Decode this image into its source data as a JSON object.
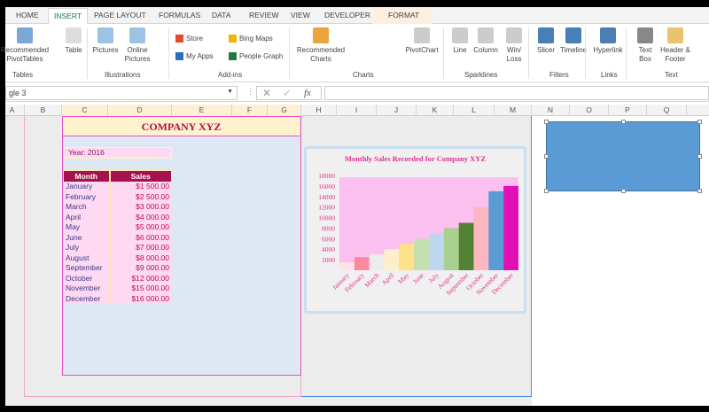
{
  "ribbon": {
    "tabs": [
      "HOME",
      "INSERT",
      "PAGE LAYOUT",
      "FORMULAS",
      "DATA",
      "REVIEW",
      "VIEW",
      "DEVELOPER",
      "FORMAT"
    ],
    "active_tab": "INSERT",
    "buttons": {
      "recommended_pivot": "Recommended PivotTables",
      "table": "Table",
      "pictures": "Pictures",
      "online_pictures": "Online Pictures",
      "store": "Store",
      "my_apps": "My Apps",
      "bing_maps": "Bing Maps",
      "people_graph": "People Graph",
      "recommended_charts": "Recommended Charts",
      "pivotchart": "PivotChart",
      "line": "Line",
      "column": "Column",
      "winloss": "Win/ Loss",
      "slicer": "Slicer",
      "timeline": "Timeline",
      "hyperlink": "Hyperlink",
      "text_box": "Text Box",
      "header_footer": "Header & Footer"
    },
    "groups": [
      "Tables",
      "Illustrations",
      "Add-ins",
      "Charts",
      "Sparklines",
      "Filters",
      "Links",
      "Text"
    ]
  },
  "formula_bar": {
    "name_box": "gle 3",
    "fx": "fx",
    "value": ""
  },
  "columns": [
    "A",
    "B",
    "C",
    "D",
    "E",
    "F",
    "G",
    "H",
    "I",
    "J",
    "K",
    "L",
    "M",
    "N",
    "O",
    "P",
    "Q"
  ],
  "sheet": {
    "title": "COMPANY XYZ",
    "year_label": "Year: 2016",
    "headers": [
      "Month",
      "Sales"
    ],
    "rows": [
      [
        "January",
        "$1 500.00"
      ],
      [
        "February",
        "$2 500.00"
      ],
      [
        "March",
        "$3 000.00"
      ],
      [
        "April",
        "$4 000.00"
      ],
      [
        "May",
        "$5 000.00"
      ],
      [
        "June",
        "$6 000.00"
      ],
      [
        "July",
        "$7 000.00"
      ],
      [
        "August",
        "$8 000.00"
      ],
      [
        "September",
        "$9 000.00"
      ],
      [
        "October",
        "$12 000.00"
      ],
      [
        "November",
        "$15 000.00"
      ],
      [
        "December",
        "$16 000.00"
      ]
    ]
  },
  "chart_data": {
    "type": "bar",
    "title": "Monthly Sales Recorded for Company XYZ",
    "categories": [
      "January",
      "February",
      "March",
      "April",
      "May",
      "June",
      "July",
      "August",
      "September",
      "October",
      "November",
      "December"
    ],
    "values": [
      1500,
      2500,
      3000,
      4000,
      5000,
      6000,
      7000,
      8000,
      9000,
      12000,
      15000,
      16000
    ],
    "colors": [
      "#fde4ea",
      "#fb8a9f",
      "#ececec",
      "#fdefca",
      "#fde28a",
      "#c5e0b0",
      "#bdd7ee",
      "#a9d08e",
      "#548235",
      "#fdb7c1",
      "#5b9bd5",
      "#e20fb5"
    ],
    "yticks": [
      2000,
      4000,
      6000,
      8000,
      10000,
      12000,
      14000,
      16000,
      18000
    ],
    "ylim": [
      0,
      18000
    ],
    "xlabel": "",
    "ylabel": ""
  },
  "shape_color": "#5b9bd5"
}
